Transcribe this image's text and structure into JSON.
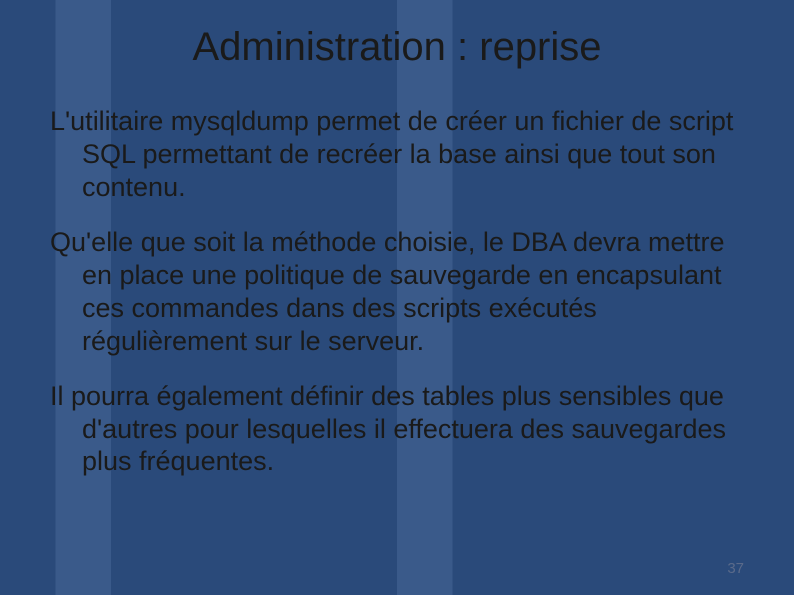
{
  "slide": {
    "title": "Administration : reprise",
    "paragraphs": [
      "L'utilitaire mysqldump permet de créer un fichier de script SQL permettant de recréer la base ainsi que tout son contenu.",
      "Qu'elle que soit la méthode choisie, le DBA devra mettre en place une politique de sauvegarde en encapsulant ces commandes dans des scripts exécutés régulièrement sur le serveur.",
      "Il pourra également définir des tables plus sensibles que d'autres pour lesquelles il effectuera des sauvegardes plus fréquentes."
    ],
    "page_number": "37"
  }
}
